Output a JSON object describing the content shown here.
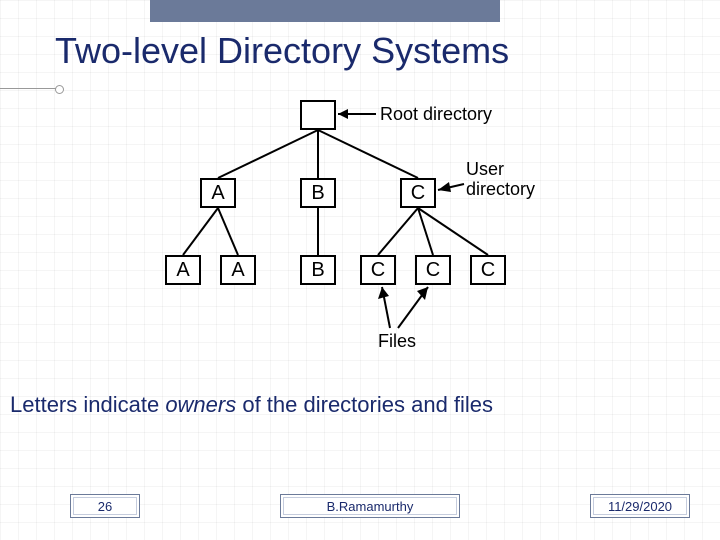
{
  "title": "Two-level Directory Systems",
  "diagram": {
    "labels": {
      "root": "Root directory",
      "user": "User\ndirectory",
      "files": "Files"
    },
    "root": "",
    "dirs": {
      "A": "A",
      "B": "B",
      "C": "C"
    },
    "files": {
      "A1": "A",
      "A2": "A",
      "B1": "B",
      "C1": "C",
      "C2": "C",
      "C3": "C"
    }
  },
  "caption_pre": "Letters indicate ",
  "caption_em": "owners",
  "caption_post": " of the directories and files",
  "footer": {
    "page": "26",
    "author": "B.Ramamurthy",
    "date": "11/29/2020"
  }
}
